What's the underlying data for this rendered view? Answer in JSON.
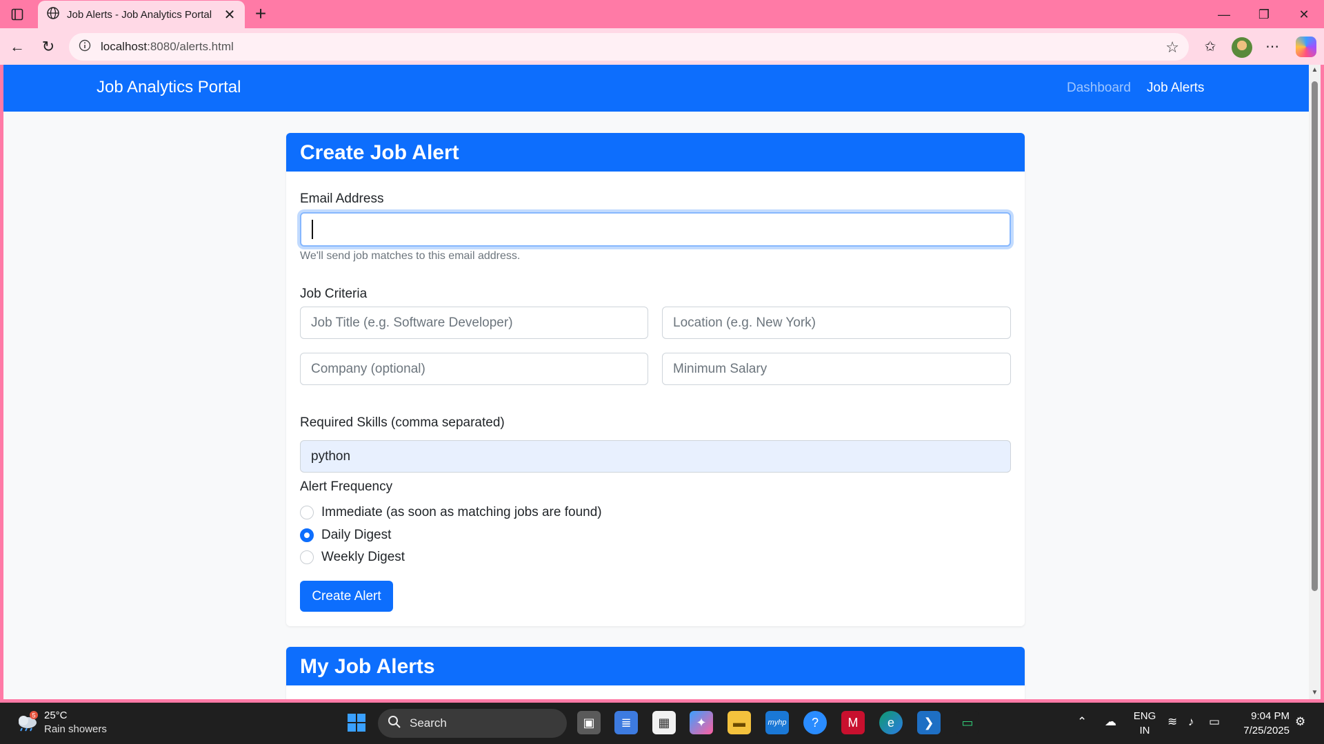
{
  "browser": {
    "tab_title": "Job Alerts - Job Analytics Portal",
    "url_host": "localhost",
    "url_rest": ":8080/alerts.html",
    "new_tab": "+",
    "close_tab": "✕"
  },
  "navbar": {
    "brand": "Job Analytics Portal",
    "links": [
      {
        "label": "Dashboard",
        "active": false
      },
      {
        "label": "Job Alerts",
        "active": true
      }
    ]
  },
  "create_card": {
    "title": "Create Job Alert",
    "email_label": "Email Address",
    "email_value": "",
    "email_help": "We'll send job matches to this email address.",
    "criteria_label": "Job Criteria",
    "job_title_placeholder": "Job Title (e.g. Software Developer)",
    "location_placeholder": "Location (e.g. New York)",
    "company_placeholder": "Company (optional)",
    "salary_placeholder": "Minimum Salary",
    "skills_label": "Required Skills (comma separated)",
    "skills_value": "python",
    "frequency_label": "Alert Frequency",
    "frequency_options": [
      {
        "label": "Immediate (as soon as matching jobs are found)",
        "checked": false
      },
      {
        "label": "Daily Digest",
        "checked": true
      },
      {
        "label": "Weekly Digest",
        "checked": false
      }
    ],
    "submit_label": "Create Alert"
  },
  "alerts_card": {
    "title": "My Job Alerts"
  },
  "taskbar": {
    "weather_temp": "25°C",
    "weather_desc": "Rain showers",
    "weather_badge": "5",
    "search_label": "Search",
    "lang_top": "ENG",
    "lang_bottom": "IN",
    "time": "9:04 PM",
    "date": "7/25/2025"
  },
  "colors": {
    "primary": "#0d6efd",
    "browser_frame": "#ff7aa6",
    "taskbar": "#1f1f1f"
  }
}
